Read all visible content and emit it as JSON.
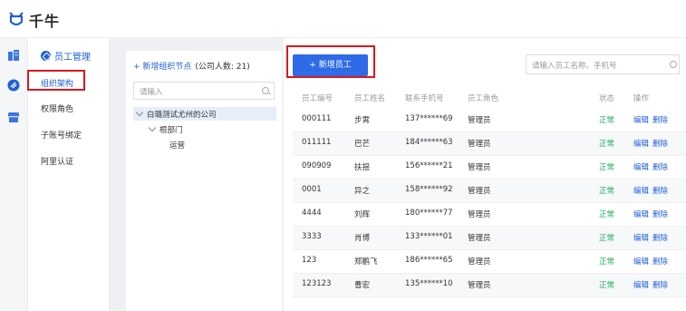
{
  "app": {
    "name": "千牛"
  },
  "nav": {
    "section_title": "员工管理",
    "items": [
      {
        "label": "组织架构",
        "active": true
      },
      {
        "label": "权限角色",
        "active": false
      },
      {
        "label": "子账号绑定",
        "active": false
      },
      {
        "label": "阿里认证",
        "active": false
      }
    ]
  },
  "org_panel": {
    "add_node_label": "+ 新增组织节点",
    "count_label": "(公司人数: 21)",
    "search_placeholder": "请输入",
    "tree": [
      {
        "label": "白璐测试尤州的公司",
        "level": 0,
        "selected": true
      },
      {
        "label": "根部门",
        "level": 1,
        "selected": false
      },
      {
        "label": "运营",
        "level": 2,
        "selected": false
      }
    ]
  },
  "main": {
    "add_employee_label": "+ 新增员工",
    "search_placeholder": "请输入员工名称、手机号",
    "columns": [
      "员工编号",
      "员工姓名",
      "联系手机号",
      "员工角色",
      "状态",
      "操作"
    ],
    "rows": [
      {
        "id": "000111",
        "name": "步霄",
        "phone": "137******69",
        "role": "管理员",
        "status": "正常"
      },
      {
        "id": "011111",
        "name": "巴芒",
        "phone": "184******63",
        "role": "管理员",
        "status": "正常"
      },
      {
        "id": "090909",
        "name": "扶揺",
        "phone": "156******21",
        "role": "管理员",
        "status": "正常"
      },
      {
        "id": "0001",
        "name": "异之",
        "phone": "158******92",
        "role": "管理员",
        "status": "正常"
      },
      {
        "id": "4444",
        "name": "刘辉",
        "phone": "180******77",
        "role": "管理员",
        "status": "正常"
      },
      {
        "id": "3333",
        "name": "肖博",
        "phone": "133******01",
        "role": "管理员",
        "status": "正常"
      },
      {
        "id": "123",
        "name": "郑鹏飞",
        "phone": "186******65",
        "role": "管理员",
        "status": "正常"
      },
      {
        "id": "123123",
        "name": "曹宏",
        "phone": "135******10",
        "role": "管理员",
        "status": "正常"
      }
    ],
    "edit_label": "编辑",
    "delete_label": "删除"
  },
  "colors": {
    "brand": "#2f6be6",
    "highlight_box": "#e0161c",
    "status_ok": "#1fb05a"
  }
}
